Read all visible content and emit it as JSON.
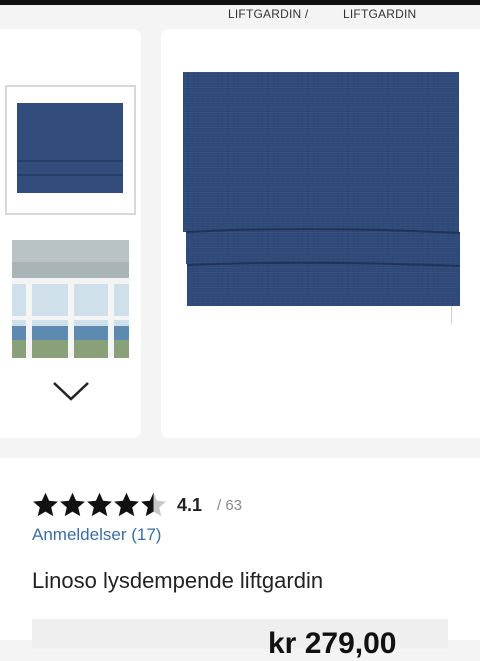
{
  "breadcrumb": {
    "first": "LIFTGARDIN /",
    "current": "LIFTGARDIN"
  },
  "gallery": {
    "thumbnails": [
      "roman-shade-navy",
      "roman-shade-window"
    ],
    "next_icon": "chevron-down-icon"
  },
  "product": {
    "rating": {
      "value": "4.1",
      "count": "/ 63",
      "stars": 4.5
    },
    "reviews_link": "Anmeldelser (17)",
    "title": "Linoso lysdempende liftgardin",
    "price": "kr 279,00"
  },
  "colors": {
    "fabric": "#2f4a78",
    "link": "#3b6ea5",
    "star": "#111111"
  }
}
